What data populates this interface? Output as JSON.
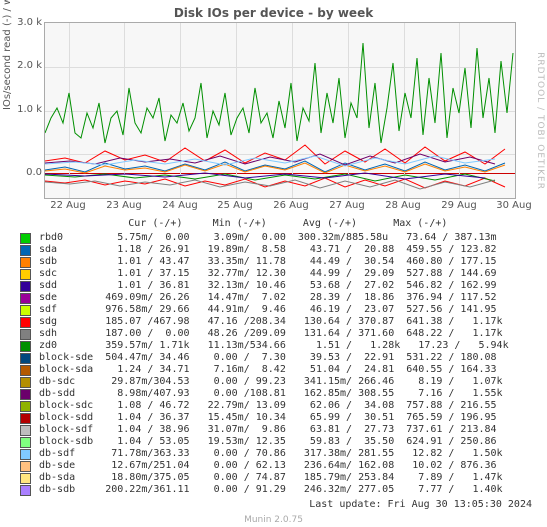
{
  "title": "Disk IOs per device - by week",
  "ylabel": "IOs/second read (-) / write (+)",
  "side_text": "RRDTOOL / TOBI OETIKER",
  "footer_version": "Munin 2.0.75",
  "last_update": "Last update: Fri Aug 30 13:05:30 2024",
  "chart_data": {
    "type": "line",
    "xlabel": "",
    "ylabel": "IOs/second read (-) / write (+)",
    "x_ticks": [
      "22 Aug",
      "23 Aug",
      "24 Aug",
      "25 Aug",
      "26 Aug",
      "27 Aug",
      "28 Aug",
      "29 Aug",
      "30 Aug"
    ],
    "y_ticks": [
      "0.0",
      "1.0 k",
      "2.0 k",
      "3.0 k"
    ],
    "ylim": [
      -500,
      3000
    ],
    "zero_at": 0,
    "note": "Dominant green trace (zd0) oscillates roughly between ~700 and ~2600, peaking near 3000 around 28 Aug. Cluster of multi-color traces hover near 0–500 on write side and 0 to -500 on read side."
  },
  "legend_header": "              Cur (-/+)     Min (-/+)      Avg (-/+)      Max (-/+)",
  "legend": [
    {
      "color": "#00cc00",
      "name": "rbd0",
      "cur": "   5.75m/  0.00",
      "min": "  3.09m/  0.00",
      "avg": "300.32m/885.58u",
      "max": " 73.64 / 387.13m"
    },
    {
      "color": "#0066b3",
      "name": "sda",
      "cur": "   1.18 / 26.91",
      "min": " 19.89m/  8.58",
      "avg": "  43.71 /  20.88",
      "max": "459.55 / 123.82"
    },
    {
      "color": "#ff8000",
      "name": "sdb",
      "cur": "   1.01 / 43.47",
      "min": " 33.35m/ 11.78",
      "avg": "  44.49 /  30.54",
      "max": "460.80 / 177.15"
    },
    {
      "color": "#ffcc00",
      "name": "sdc",
      "cur": "   1.01 / 37.15",
      "min": " 32.77m/ 12.30",
      "avg": "  44.99 /  29.09",
      "max": "527.88 / 144.69"
    },
    {
      "color": "#330099",
      "name": "sdd",
      "cur": "   1.01 / 36.81",
      "min": " 32.13m/ 10.46",
      "avg": "  53.68 /  27.02",
      "max": "546.82 / 162.99"
    },
    {
      "color": "#990099",
      "name": "sde",
      "cur": " 469.09m/ 26.26",
      "min": " 14.47m/  7.02",
      "avg": "  28.39 /  18.86",
      "max": "376.94 / 117.52"
    },
    {
      "color": "#ccff00",
      "name": "sdf",
      "cur": " 976.58m/ 29.66",
      "min": " 44.91m/  9.46",
      "avg": "  46.19 /  23.07",
      "max": "527.56 / 141.95"
    },
    {
      "color": "#ff0000",
      "name": "sdg",
      "cur": " 185.07 /467.98",
      "min": " 47.16 /208.34",
      "avg": " 130.64 / 370.87",
      "max": "641.38 /   1.17k"
    },
    {
      "color": "#808080",
      "name": "sdh",
      "cur": " 187.00 /  0.00",
      "min": " 48.26 /209.09",
      "avg": " 131.64 / 371.60",
      "max": "648.22 /   1.17k"
    },
    {
      "color": "#008f00",
      "name": "zd0",
      "cur": " 359.57m/ 1.71k",
      "min": " 11.13m/534.66",
      "avg": "   1.51 /   1.28k",
      "max": " 17.23 /   5.94k"
    },
    {
      "color": "#00487d",
      "name": "block-sde",
      "cur": " 504.47m/ 34.46",
      "min": "  0.00 /  7.30",
      "avg": "  39.53 /  22.91",
      "max": "531.22 / 180.08"
    },
    {
      "color": "#b35a00",
      "name": "block-sda",
      "cur": "   1.24 / 34.71",
      "min": "  7.16m/  8.42",
      "avg": "  51.04 /  24.81",
      "max": "640.55 / 164.33"
    },
    {
      "color": "#b38f00",
      "name": "db-sdc",
      "cur": "  29.87m/304.53",
      "min": "  0.00 / 99.23",
      "avg": " 341.15m/ 266.46",
      "max": "  8.19 /   1.07k"
    },
    {
      "color": "#6b006b",
      "name": "db-sdd",
      "cur": "   8.98m/407.93",
      "min": "  0.00 /108.81",
      "avg": " 162.85m/ 308.55",
      "max": "  7.16 /   1.55k"
    },
    {
      "color": "#8fb300",
      "name": "block-sdc",
      "cur": "   1.08 / 46.72",
      "min": " 22.79m/ 13.09",
      "avg": "  62.06 /  34.08",
      "max": "757.88 / 216.55"
    },
    {
      "color": "#b30000",
      "name": "block-sdd",
      "cur": "   1.04 / 36.37",
      "min": " 15.45m/ 10.34",
      "avg": "  65.99 /  30.51",
      "max": "765.59 / 196.95"
    },
    {
      "color": "#bebebe",
      "name": "block-sdf",
      "cur": "   1.04 / 38.96",
      "min": " 31.07m/  9.86",
      "avg": "  63.81 /  27.73",
      "max": "737.61 / 213.84"
    },
    {
      "color": "#80ff80",
      "name": "block-sdb",
      "cur": "   1.04 / 53.05",
      "min": " 19.53m/ 12.35",
      "avg": "  59.83 /  35.50",
      "max": "624.91 / 250.86"
    },
    {
      "color": "#80c9ff",
      "name": "db-sdf",
      "cur": "  71.78m/363.33",
      "min": "  0.00 / 70.86",
      "avg": " 317.38m/ 281.55",
      "max": " 12.82 /   1.50k"
    },
    {
      "color": "#ffc080",
      "name": "db-sde",
      "cur": "  12.67m/251.04",
      "min": "  0.00 / 62.13",
      "avg": " 236.64m/ 162.08",
      "max": " 10.02 / 876.36"
    },
    {
      "color": "#ffe680",
      "name": "db-sda",
      "cur": "  18.80m/375.05",
      "min": "  0.00 / 74.87",
      "avg": " 185.79m/ 253.84",
      "max": "  7.89 /   1.47k"
    },
    {
      "color": "#aa80ff",
      "name": "db-sdb",
      "cur": " 200.22m/361.11",
      "min": "  0.00 / 91.29",
      "avg": " 246.32m/ 277.05",
      "max": "  7.77 /   1.40k"
    }
  ]
}
